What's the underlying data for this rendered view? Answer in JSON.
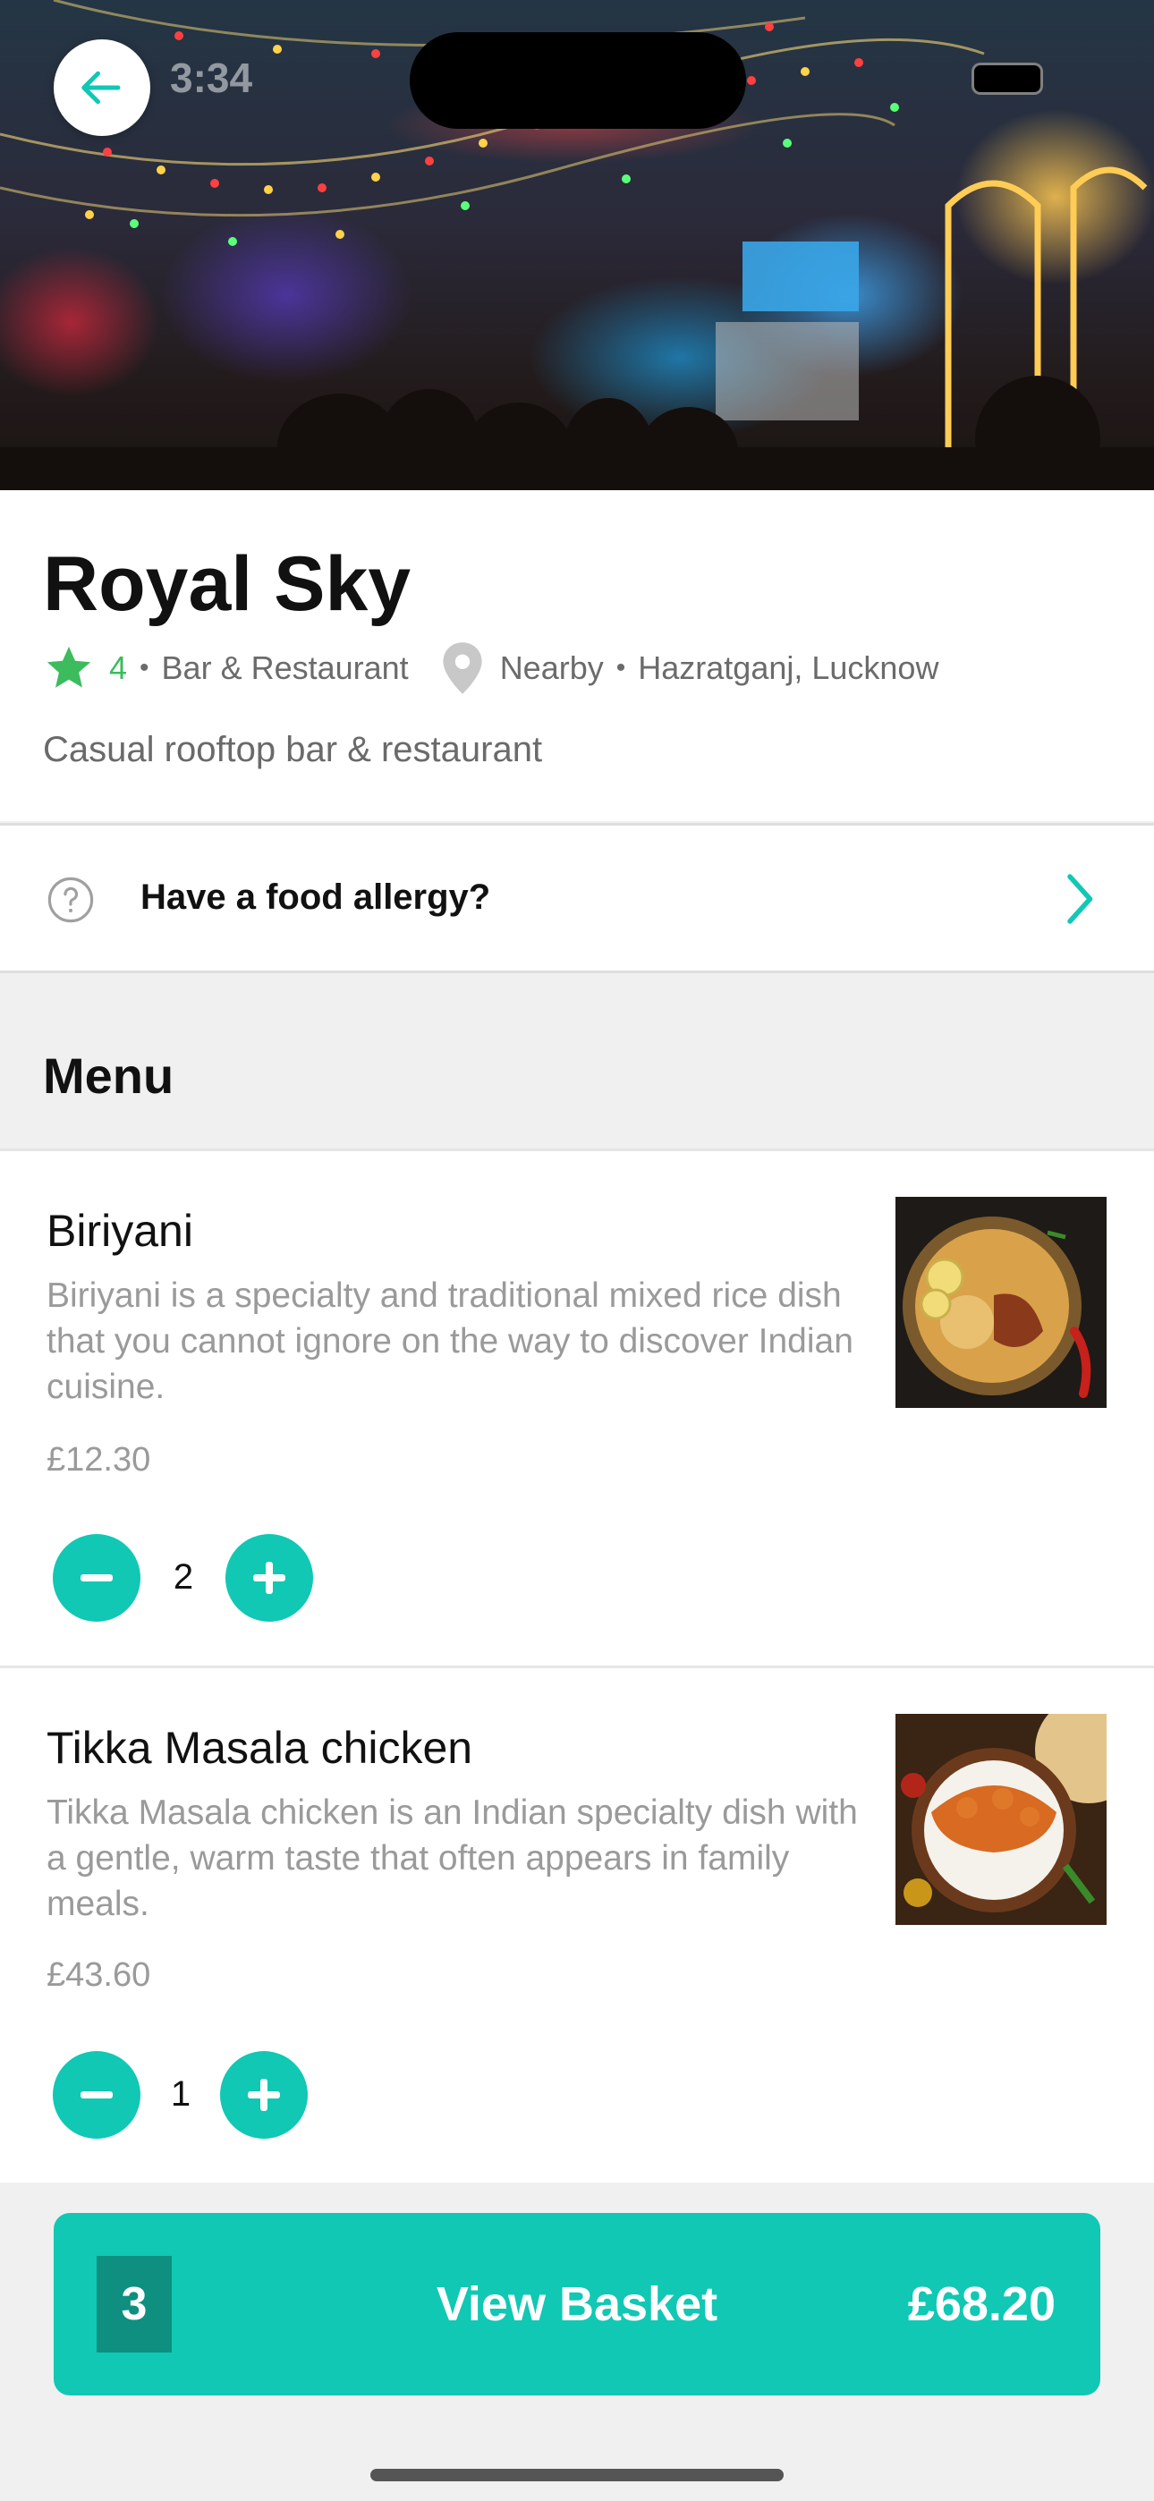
{
  "status_bar": {
    "time": "3:34"
  },
  "restaurant": {
    "name": "Royal Sky",
    "rating": "4",
    "bullet": "•",
    "category": "Bar & Restaurant",
    "distance": "Nearby",
    "location": "Hazratganj, Lucknow",
    "tagline": "Casual rooftop bar & restaurant"
  },
  "allergy": {
    "label": "Have a food allergy?"
  },
  "menu": {
    "heading": "Menu",
    "items": [
      {
        "name": "Biriyani",
        "description": "Biriyani is a specialty and traditional mixed rice dish that you cannot ignore on the way to discover Indian cuisine.",
        "price": "£12.30",
        "quantity": "2"
      },
      {
        "name": "Tikka Masala chicken",
        "description": "Tikka Masala chicken is an Indian specialty dish with a gentle, warm taste that often appears in family meals.",
        "price": "£43.60",
        "quantity": "1"
      }
    ]
  },
  "basket": {
    "count": "3",
    "label": "View Basket",
    "total": "£68.20"
  },
  "colors": {
    "accent": "#10c8b4",
    "accent_dark": "#0e8f80",
    "rating_green": "#3cbc5c",
    "muted_text": "#9a9a9a"
  },
  "icons": [
    "arrow-left-icon",
    "star-icon",
    "map-pin-icon",
    "question-circle-icon",
    "chevron-right-icon",
    "minus-icon",
    "plus-icon"
  ]
}
